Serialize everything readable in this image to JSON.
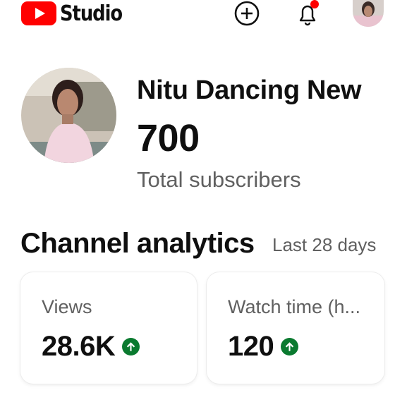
{
  "header": {
    "app_name": "Studio",
    "logo_icon": "youtube-logo-icon",
    "brand_color": "#ff0000",
    "create_icon": "create-plus-icon",
    "notification_icon": "bell-icon",
    "notification_badge_color": "#ff0000",
    "account_icon": "account-avatar"
  },
  "channel": {
    "name": "Nitu Dancing New",
    "subscriber_count": "700",
    "subscriber_label": "Total subscribers"
  },
  "analytics": {
    "title": "Channel analytics",
    "range": "Last 28 days",
    "trend_color": "#0a7a2f",
    "cards": [
      {
        "label": "Views",
        "value": "28.6K",
        "trend_icon": "arrow-up-icon"
      },
      {
        "label": "Watch time (h...",
        "value": "120",
        "trend_icon": "arrow-up-icon"
      }
    ]
  }
}
